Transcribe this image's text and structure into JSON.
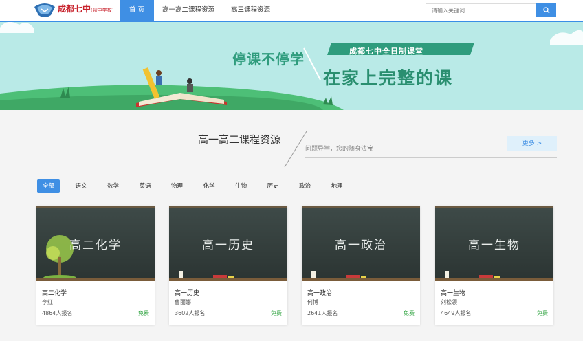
{
  "header": {
    "logo_text": "成都七中",
    "logo_sub": "(初中学校)",
    "nav": [
      {
        "label": "首 页",
        "active": true
      },
      {
        "label": "高一高二课程资源",
        "active": false
      },
      {
        "label": "高三课程资源",
        "active": false
      }
    ],
    "search_placeholder": "请输入关键词",
    "search_icon": "search-icon"
  },
  "banner": {
    "slogan_left": "停课不停学",
    "slogan_tag": "成都七中全日制课堂",
    "slogan_main": "在家上完整的课"
  },
  "section": {
    "title": "高一高二课程资源",
    "subtitle": "问题导学，您的随身法宝",
    "more_label": "更多 >"
  },
  "filters": [
    "全部",
    "语文",
    "数学",
    "英语",
    "物理",
    "化学",
    "生物",
    "历史",
    "政治",
    "地理"
  ],
  "cards": [
    {
      "board_text": "高二化学",
      "title": "高二化学",
      "teacher": "李红",
      "count": "4864人报名",
      "price": "免费"
    },
    {
      "board_text": "高一历史",
      "title": "高一历史",
      "teacher": "曹丽娜",
      "count": "3602人报名",
      "price": "免费"
    },
    {
      "board_text": "高一政治",
      "title": "高一政治",
      "teacher": "何博",
      "count": "2641人报名",
      "price": "免费"
    },
    {
      "board_text": "高一生物",
      "title": "高一生物",
      "teacher": "刘松领",
      "count": "4649人报名",
      "price": "免费"
    }
  ],
  "colors": {
    "accent": "#3f8fe4",
    "banner_bg": "#b9eae7",
    "free": "#3aa84a",
    "logo_red": "#c8222c"
  }
}
